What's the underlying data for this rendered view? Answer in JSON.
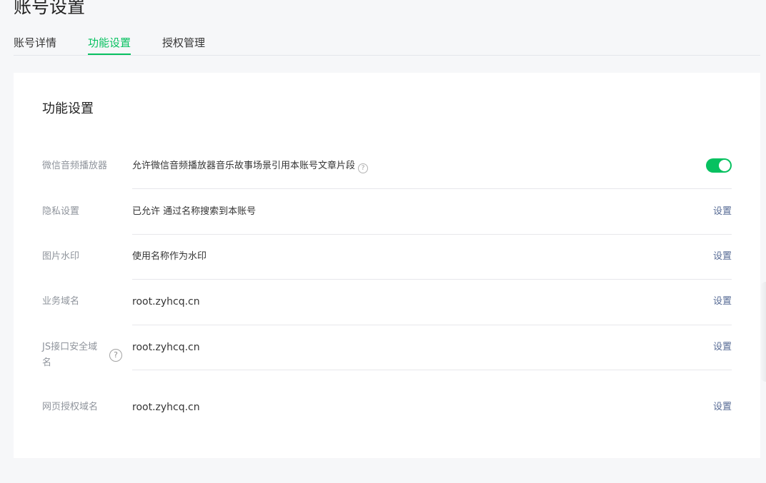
{
  "page": {
    "title": "账号设置"
  },
  "tabs": [
    {
      "label": "账号详情",
      "active": false
    },
    {
      "label": "功能设置",
      "active": true
    },
    {
      "label": "授权管理",
      "active": false
    }
  ],
  "card": {
    "title": "功能设置",
    "rows": [
      {
        "label": "微信音频播放器",
        "value": "允许微信音频播放器音乐故事场景引用本账号文章片段",
        "control": "toggle",
        "toggle_on": true,
        "help_icon": "question-circle-icon"
      },
      {
        "label": "隐私设置",
        "value": "已允许 通过名称搜索到本账号",
        "action": "设置"
      },
      {
        "label": "图片水印",
        "value": "使用名称作为水印",
        "action": "设置"
      },
      {
        "label": "业务域名",
        "value": "root.zyhcq.cn",
        "action": "设置"
      },
      {
        "label_line1": "JS接口安全域",
        "label_line2": "名",
        "value": "root.zyhcq.cn",
        "action": "设置",
        "help_icon": "question-circle-icon"
      },
      {
        "label": "网页授权域名",
        "value": "root.zyhcq.cn",
        "action": "设置"
      }
    ]
  },
  "colors": {
    "accent": "#07c160",
    "link": "#576b95",
    "label": "#8f949c",
    "background": "#f6f7f9"
  }
}
